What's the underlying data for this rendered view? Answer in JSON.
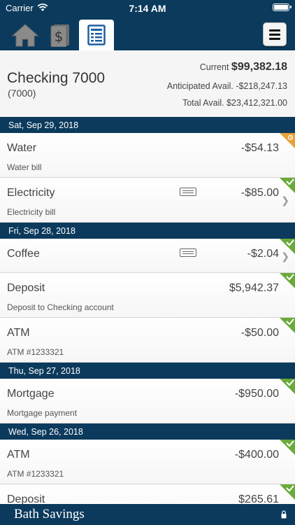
{
  "status_bar": {
    "carrier": "Carrier",
    "time": "7:14 AM"
  },
  "nav": {
    "tabs": [
      {
        "icon": "home-icon"
      },
      {
        "icon": "money-icon"
      },
      {
        "icon": "register-icon",
        "selected": true
      }
    ],
    "menu_icon": "hamburger-menu-icon"
  },
  "account": {
    "name": "Checking 7000",
    "number": "(7000)",
    "current_label": "Current",
    "current_value": "$99,382.18",
    "anticipated": "Anticipated Avail. -$218,247.13",
    "total": "Total Avail. $23,412,321.00"
  },
  "groups": [
    {
      "date": "Sat, Sep 29, 2018",
      "transactions": [
        {
          "name": "Water",
          "memo": "Water bill",
          "amount": "-$54.13",
          "status": "pending",
          "receipt": false,
          "chevron": false
        },
        {
          "name": "Electricity",
          "memo": "Electricity bill",
          "amount": "-$85.00",
          "status": "cleared",
          "receipt": true,
          "chevron": true
        }
      ]
    },
    {
      "date": "Fri, Sep 28, 2018",
      "transactions": [
        {
          "name": "Coffee",
          "memo": "",
          "amount": "-$2.04",
          "status": "cleared",
          "receipt": true,
          "chevron": true
        },
        {
          "name": "Deposit",
          "memo": "Deposit to Checking account",
          "amount": "$5,942.37",
          "status": "cleared",
          "receipt": false,
          "chevron": false
        },
        {
          "name": "ATM",
          "memo": "ATM #1233321",
          "amount": "-$50.00",
          "status": "cleared",
          "receipt": false,
          "chevron": false
        }
      ]
    },
    {
      "date": "Thu, Sep 27, 2018",
      "transactions": [
        {
          "name": "Mortgage",
          "memo": "Mortgage payment",
          "amount": "-$950.00",
          "status": "cleared",
          "receipt": false,
          "chevron": false
        }
      ]
    },
    {
      "date": "Wed, Sep 26, 2018",
      "transactions": [
        {
          "name": "ATM",
          "memo": "ATM #1233321",
          "amount": "-$400.00",
          "status": "cleared",
          "receipt": false,
          "chevron": false
        },
        {
          "name": "Deposit",
          "memo": "",
          "amount": "$265.61",
          "status": "cleared",
          "receipt": false,
          "chevron": false
        }
      ]
    }
  ],
  "footer": {
    "brand": "Bath Savings"
  },
  "colors": {
    "navy": "#0b3a5c",
    "cleared": "#6aaa3a",
    "pending": "#e8a23a"
  }
}
